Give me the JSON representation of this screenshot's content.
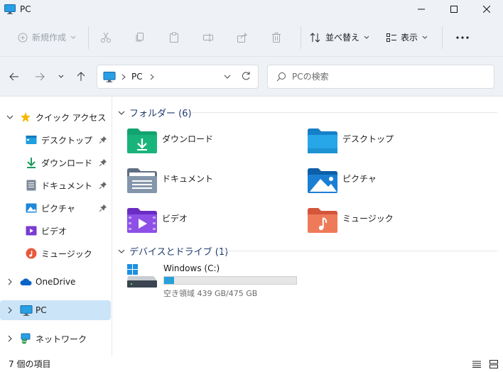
{
  "window": {
    "title": "PC"
  },
  "toolbar": {
    "new_label": "新規作成",
    "sort_label": "並べ替え",
    "view_label": "表示"
  },
  "address": {
    "crumb": "PC"
  },
  "search": {
    "placeholder": "PCの検索"
  },
  "sidebar": {
    "quick_access": "クイック アクセス",
    "items": [
      {
        "label": "デスクトップ",
        "icon": "desktop-icon"
      },
      {
        "label": "ダウンロード",
        "icon": "download-icon"
      },
      {
        "label": "ドキュメント",
        "icon": "documents-icon"
      },
      {
        "label": "ピクチャ",
        "icon": "pictures-icon"
      },
      {
        "label": "ビデオ",
        "icon": "videos-icon"
      },
      {
        "label": "ミュージック",
        "icon": "music-icon"
      }
    ],
    "onedrive": "OneDrive",
    "pc": "PC",
    "network": "ネットワーク"
  },
  "content": {
    "folders_header": "フォルダー (6)",
    "folders": [
      {
        "name": "ダウンロード",
        "icon": "download-folder-icon"
      },
      {
        "name": "デスクトップ",
        "icon": "desktop-folder-icon"
      },
      {
        "name": "ドキュメント",
        "icon": "documents-folder-icon"
      },
      {
        "name": "ピクチャ",
        "icon": "pictures-folder-icon"
      },
      {
        "name": "ビデオ",
        "icon": "videos-folder-icon"
      },
      {
        "name": "ミュージック",
        "icon": "music-folder-icon"
      }
    ],
    "drives_header": "デバイスとドライブ (1)",
    "drive": {
      "name": "Windows (C:)",
      "free_text": "空き領域 439 GB/475 GB",
      "used_fraction": 0.076
    }
  },
  "status": {
    "count": "7 個の項目"
  },
  "colors": {
    "accent": "#0067c0",
    "selection": "#cce4f7",
    "chrome": "#eef2f7",
    "drive_bar": "#26a0da"
  }
}
